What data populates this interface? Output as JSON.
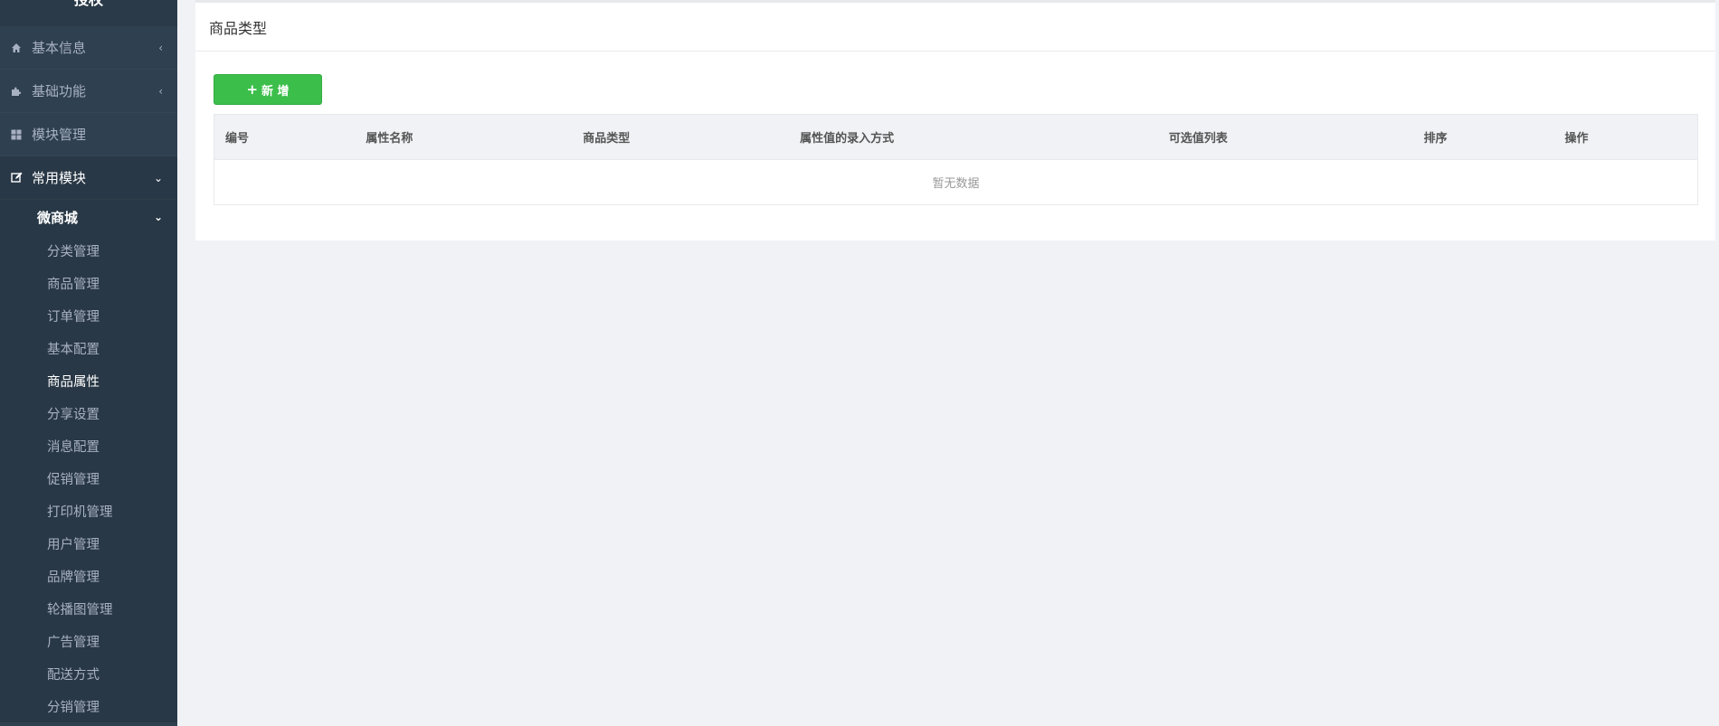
{
  "sidebar": {
    "logo": "授权",
    "top_items": [
      {
        "label": "基本信息",
        "icon": "home-icon"
      },
      {
        "label": "基础功能",
        "icon": "puzzle-icon"
      },
      {
        "label": "模块管理",
        "icon": "grid-icon"
      },
      {
        "label": "常用模块",
        "icon": "edit-icon"
      }
    ],
    "group": "微商城",
    "leaves": [
      "分类管理",
      "商品管理",
      "订单管理",
      "基本配置",
      "商品属性",
      "分享设置",
      "消息配置",
      "促销管理",
      "打印机管理",
      "用户管理",
      "品牌管理",
      "轮播图管理",
      "广告管理",
      "配送方式",
      "分销管理"
    ],
    "active_leaf": "商品属性"
  },
  "panel": {
    "title": "商品类型",
    "add_label": "新 增"
  },
  "table": {
    "columns": [
      "编号",
      "属性名称",
      "商品类型",
      "属性值的录入方式",
      "可选值列表",
      "排序",
      "操作"
    ],
    "empty_text": "暂无数据"
  },
  "colors": {
    "sidebar_bg": "#2f4050",
    "accent_green": "#3cbe4b",
    "page_bg": "#f0f2f6"
  }
}
